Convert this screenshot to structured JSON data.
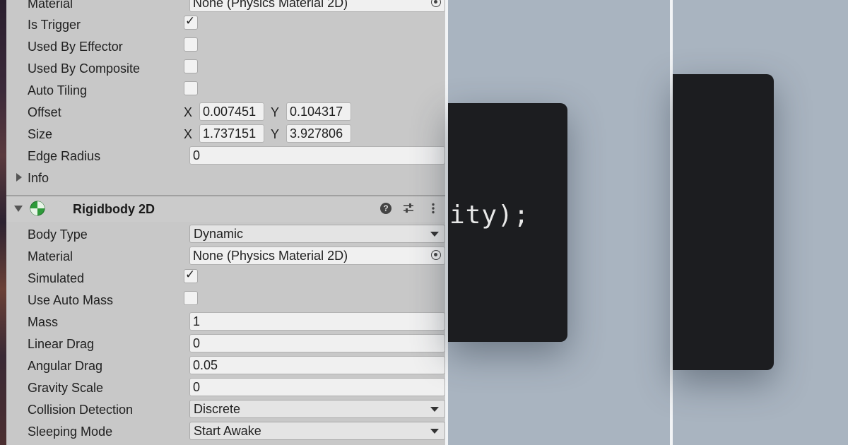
{
  "inspector": {
    "rows_top": [
      {
        "label": "Material",
        "kind": "object",
        "value": "None (Physics Material 2D)"
      },
      {
        "label": "Is Trigger",
        "kind": "checkbox",
        "checked": true
      },
      {
        "label": "Used By Effector",
        "kind": "checkbox",
        "checked": false
      },
      {
        "label": "Used By Composite",
        "kind": "checkbox",
        "checked": false
      },
      {
        "label": "Auto Tiling",
        "kind": "checkbox",
        "checked": false
      }
    ],
    "offset": {
      "label": "Offset",
      "x_label": "X",
      "x": "0.007451",
      "y_label": "Y",
      "y": "0.104317"
    },
    "size": {
      "label": "Size",
      "x_label": "X",
      "x": "1.737151",
      "y_label": "Y",
      "y": "3.927806"
    },
    "edge_radius": {
      "label": "Edge Radius",
      "value": "0"
    },
    "info": {
      "label": "Info"
    },
    "rigidbody": {
      "title": "Rigidbody 2D",
      "help_glyph": "?",
      "rows": [
        {
          "label": "Body Type",
          "kind": "dropdown",
          "value": "Dynamic"
        },
        {
          "label": "Material",
          "kind": "object",
          "value": "None (Physics Material 2D)"
        },
        {
          "label": "Simulated",
          "kind": "checkbox",
          "checked": true
        },
        {
          "label": "Use Auto Mass",
          "kind": "checkbox",
          "checked": false
        },
        {
          "label": "Mass",
          "kind": "text",
          "value": "1"
        },
        {
          "label": "Linear Drag",
          "kind": "text",
          "value": "0"
        },
        {
          "label": "Angular Drag",
          "kind": "text",
          "value": "0.05"
        },
        {
          "label": "Gravity Scale",
          "kind": "text",
          "value": "0"
        },
        {
          "label": "Collision Detection",
          "kind": "dropdown",
          "value": "Discrete"
        },
        {
          "label": "Sleeping Mode",
          "kind": "dropdown",
          "value": "Start Awake"
        }
      ]
    },
    "check_glyph": "✓"
  },
  "code_snippet": {
    "text": "ity);"
  },
  "colors": {
    "panel": "#c8c8c8",
    "field": "#f0f0f0",
    "card": "#1c1d20",
    "backdrop": "#a9b4c0",
    "rigidbody_icon": "#2e9a3a"
  }
}
